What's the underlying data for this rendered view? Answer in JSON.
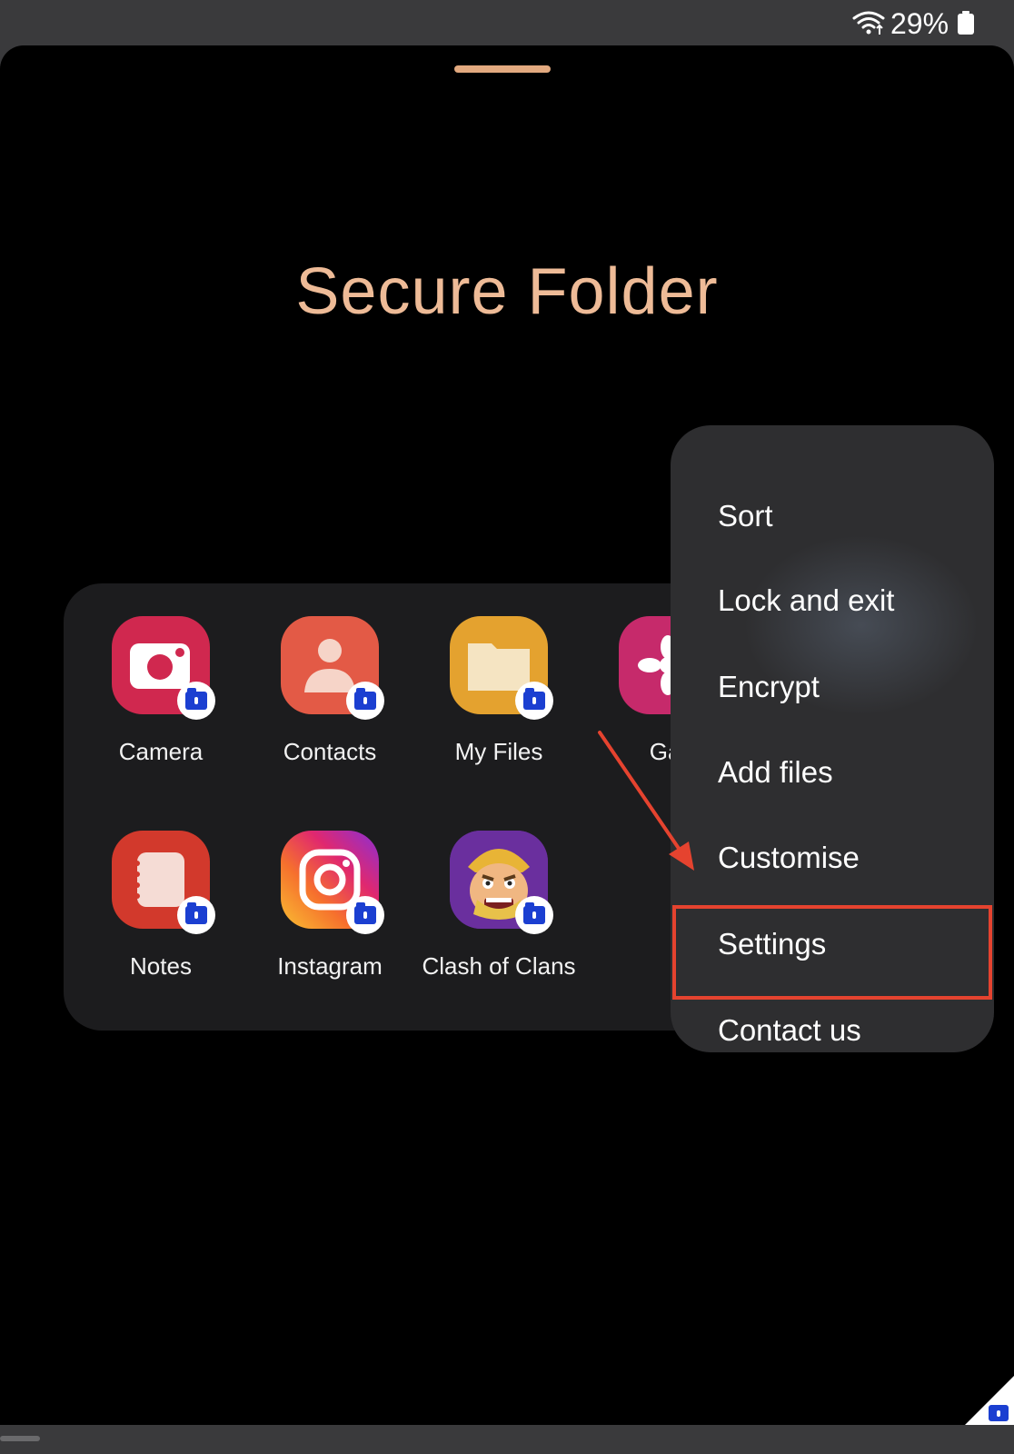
{
  "status_bar": {
    "battery_percent": "29%"
  },
  "title": "Secure Folder",
  "apps": [
    {
      "label": "Camera",
      "icon": "camera-icon"
    },
    {
      "label": "Contacts",
      "icon": "contacts-icon"
    },
    {
      "label": "My Files",
      "icon": "folder-icon"
    },
    {
      "label": "Gal",
      "icon": "gallery-icon"
    },
    {
      "label": "Notes",
      "icon": "notes-icon"
    },
    {
      "label": "Instagram",
      "icon": "instagram-icon"
    },
    {
      "label": "Clash of Clans",
      "icon": "clash-of-clans-icon"
    }
  ],
  "menu": {
    "items": [
      {
        "label": "Sort"
      },
      {
        "label": "Lock and exit"
      },
      {
        "label": "Encrypt"
      },
      {
        "label": "Add files"
      },
      {
        "label": "Customise"
      },
      {
        "label": "Settings"
      },
      {
        "label": "Contact us"
      }
    ],
    "highlighted": "Settings"
  },
  "colors": {
    "accent": "#eebb97",
    "highlight_box": "#e5432f",
    "badge": "#1b3fd1"
  }
}
